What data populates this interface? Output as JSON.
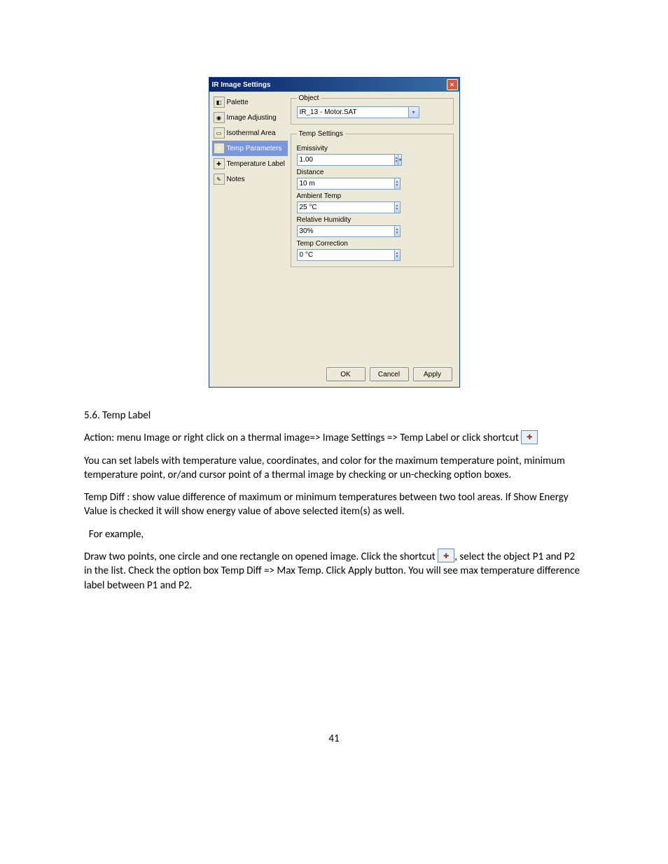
{
  "dialog": {
    "title": "IR Image Settings",
    "sidebar": {
      "items": [
        {
          "label": "Palette",
          "hint": "◧"
        },
        {
          "label": "Image Adjusting",
          "hint": "◉"
        },
        {
          "label": "Isothermal Area",
          "hint": "▭"
        },
        {
          "label": "Temp Parameters",
          "hint": "≣"
        },
        {
          "label": "Temperature Label",
          "hint": "✚"
        },
        {
          "label": "Notes",
          "hint": "✎"
        }
      ]
    },
    "object": {
      "legend": "Object",
      "value": "IR_13 - Motor.SAT"
    },
    "temp_settings": {
      "legend": "Temp Settings",
      "fields": [
        {
          "label": "Emissivity",
          "value": "1.00",
          "combo": true
        },
        {
          "label": "Distance",
          "value": "10 m"
        },
        {
          "label": "Ambient Temp",
          "value": "25 °C"
        },
        {
          "label": "Relative Humidity",
          "value": "30%"
        },
        {
          "label": "Temp Correction",
          "value": "0 °C"
        }
      ]
    },
    "buttons": {
      "ok": "OK",
      "cancel": "Cancel",
      "apply": "Apply"
    }
  },
  "doc": {
    "section_heading": "5.6. Temp Label",
    "p1a": "Action: menu Image or right click on a thermal image=> Image Settings => Temp Label or click shortcut",
    "p2": "You can set labels with temperature value, coordinates, and color for the maximum temperature point, minimum temperature point, or/and cursor point of a thermal image by checking or un-checking option boxes.",
    "p3": "Temp Diff : show value difference of maximum or minimum temperatures between two tool areas. If Show Energy Value is checked it will show energy value of above selected item(s) as well.",
    "p4": "  For example,",
    "p5a": "Draw two points, one circle and one rectangle on opened image.  Click the shortcut ",
    "p5b": ", select the object P1 and P2 in the list.  Check the option box Temp Diff => Max Temp.  Click Apply button.  You will see max temperature difference label between P1 and P2.",
    "page_num": "41"
  }
}
